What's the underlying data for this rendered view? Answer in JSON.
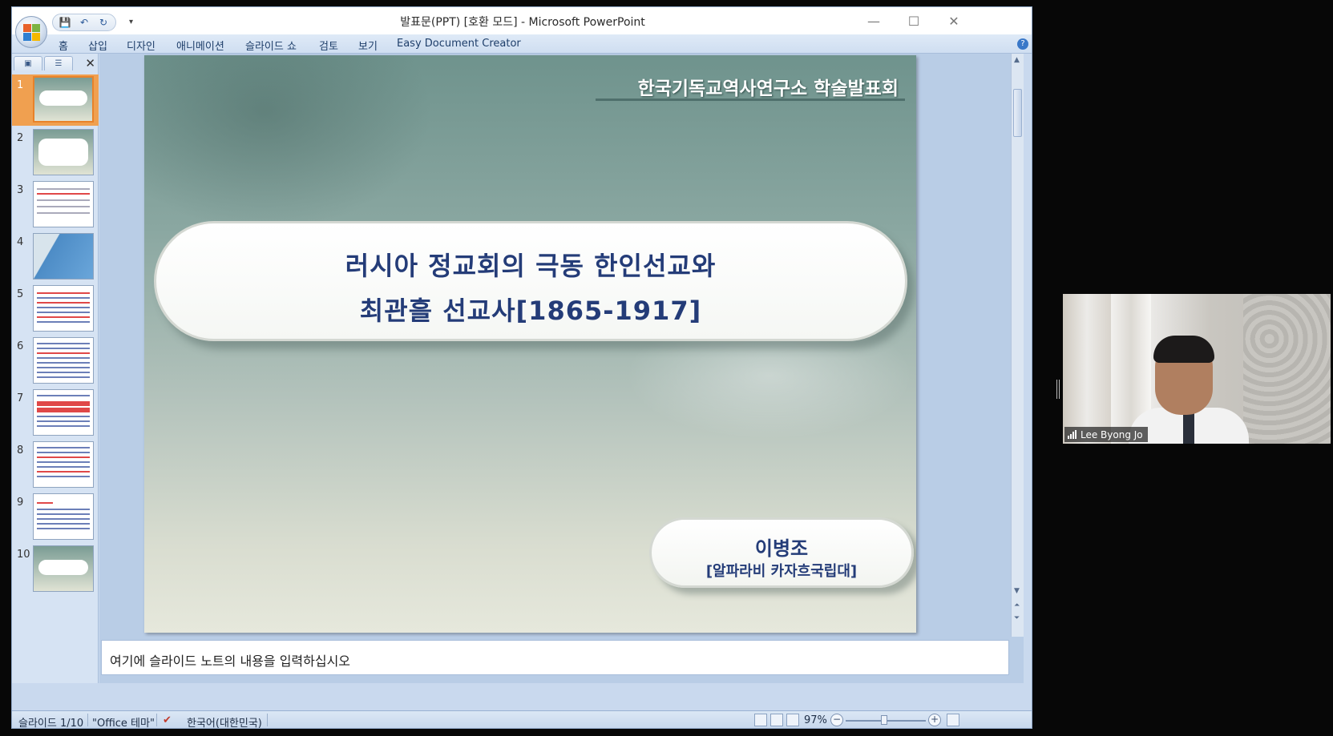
{
  "window": {
    "title": "발표문(PPT) [호환 모드] - Microsoft PowerPoint",
    "minimize": "—",
    "maximize": "☐",
    "close": "✕"
  },
  "ribbon": {
    "tabs": [
      "홈",
      "삽입",
      "디자인",
      "애니메이션",
      "슬라이드 쇼",
      "검토",
      "보기",
      "Easy Document Creator"
    ]
  },
  "quick_access": {
    "save": "💾",
    "undo": "↶",
    "redo": "↻",
    "more": "▾"
  },
  "slide_panel": {
    "close": "✕",
    "numbers": [
      "1",
      "2",
      "3",
      "4",
      "5",
      "6",
      "7",
      "8",
      "9",
      "10"
    ]
  },
  "slide": {
    "header": "한국기독교역사연구소 학술발표회",
    "title_line1": "러시아 정교회의 극동 한인선교와",
    "title_line2": "최관흘 선교사[1865-1917]",
    "author_name": "이병조",
    "author_affiliation": "[알파라비 카자흐국립대]"
  },
  "notes": {
    "placeholder": "여기에 슬라이드 노트의 내용을 입력하십시오"
  },
  "status_bar": {
    "slide_info": "슬라이드 1/10",
    "theme": "\"Office 테마\"",
    "language": "한국어(대한민국)",
    "zoom": "97%",
    "zoom_value": 97
  },
  "video": {
    "participant_name": "Lee Byong Jo"
  },
  "colors": {
    "title_text": "#243c78",
    "active_thumb": "#f0a050"
  }
}
